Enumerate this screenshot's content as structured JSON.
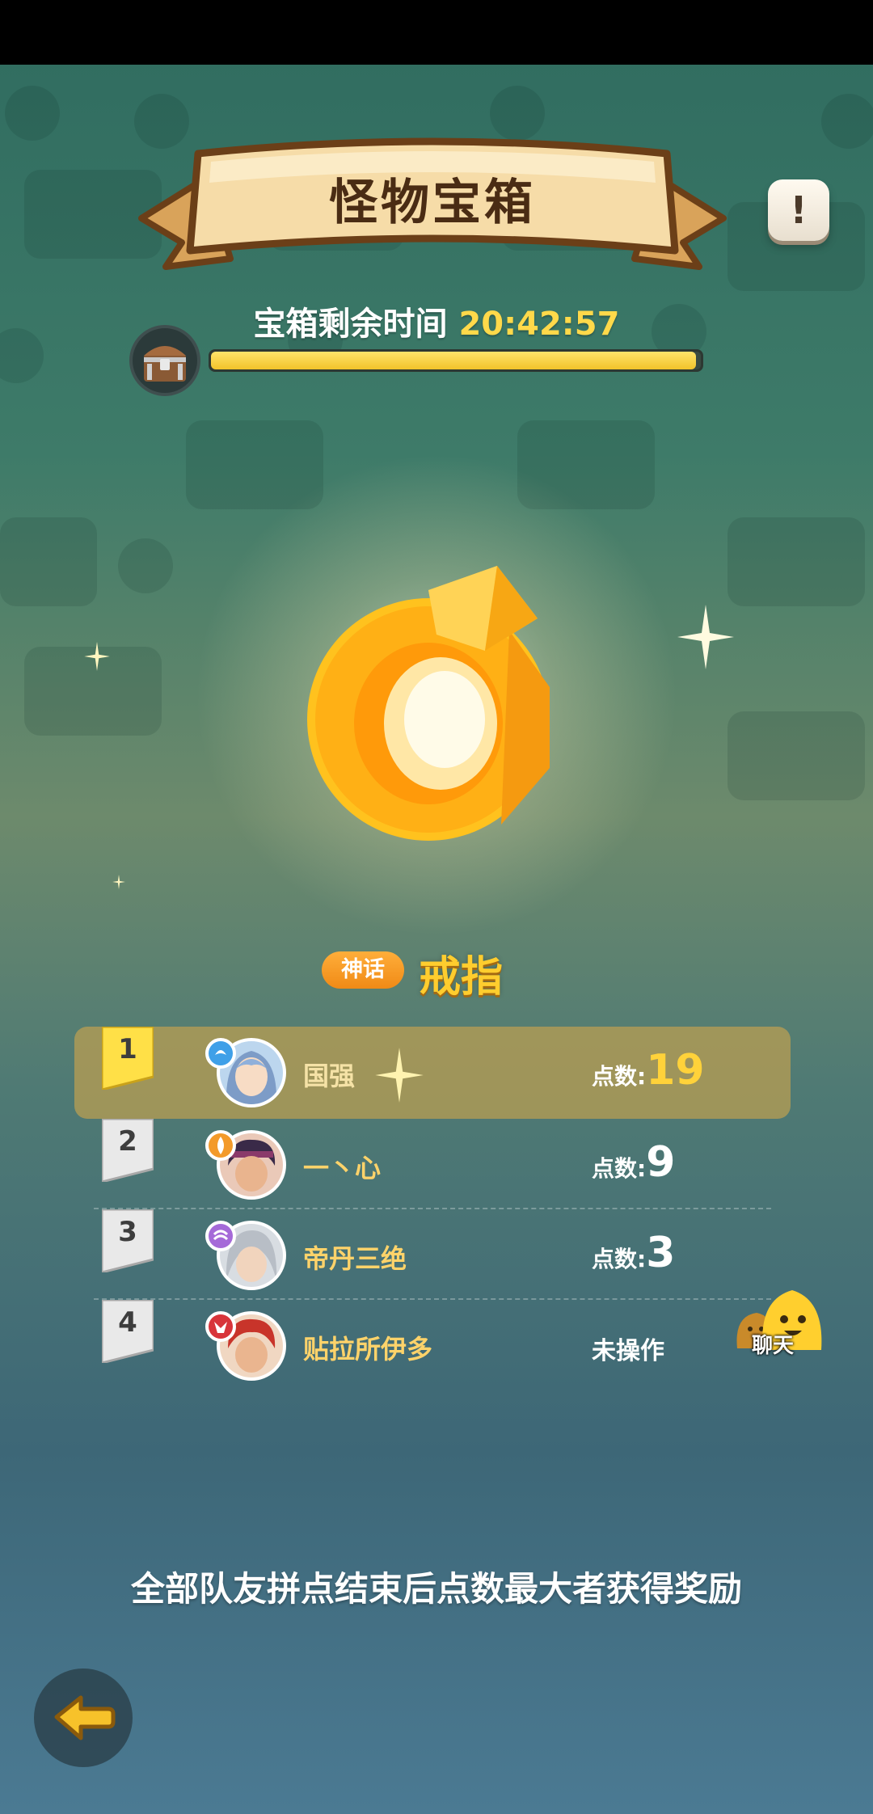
{
  "header": {
    "title": "怪物宝箱",
    "info_icon": "exclamation-icon"
  },
  "timer": {
    "label": "宝箱剩余时间",
    "value": "20:42:57",
    "progress": 0.99,
    "icon": "treasure-chest-icon"
  },
  "item": {
    "rarity": "神话",
    "name": "戒指",
    "icon": "gold-ring-icon"
  },
  "ranking": [
    {
      "rank": "1",
      "name": "国强",
      "points_label": "点数:",
      "points": "19",
      "status": "",
      "element": "water"
    },
    {
      "rank": "2",
      "name": "一丶心",
      "points_label": "点数:",
      "points": "9",
      "status": "",
      "element": "fire"
    },
    {
      "rank": "3",
      "name": "帝丹三绝",
      "points_label": "点数:",
      "points": "3",
      "status": "",
      "element": "wind"
    },
    {
      "rank": "4",
      "name": "贴拉所伊多",
      "points_label": "",
      "points": "",
      "status": "未操作",
      "element": "demon"
    }
  ],
  "chat": {
    "label": "聊天",
    "icon": "chat-faces-icon"
  },
  "footer": {
    "hint": "全部队友拼点结束后点数最大者获得奖励"
  },
  "back": {
    "icon": "back-arrow-icon"
  },
  "colors": {
    "accent_gold": "#ffd23a",
    "rarity_orange": "#f08a16",
    "banner": "#f2d29a"
  }
}
